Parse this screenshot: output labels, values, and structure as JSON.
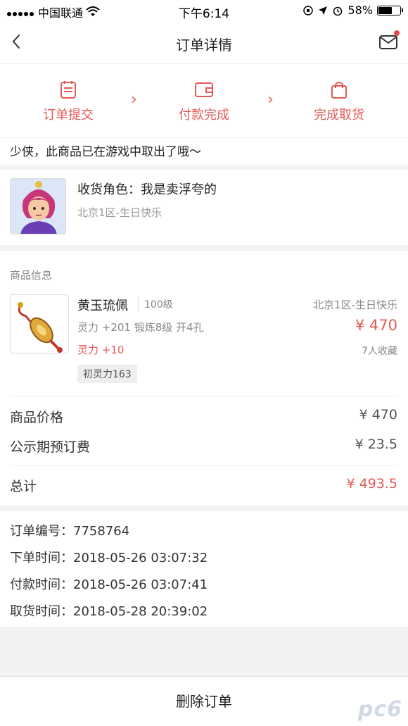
{
  "status_bar": {
    "carrier": "中国联通",
    "time": "下午6:14",
    "battery": "58%"
  },
  "nav": {
    "title": "订单详情"
  },
  "steps": [
    {
      "label": "订单提交",
      "icon": "clipboard-icon"
    },
    {
      "label": "付款完成",
      "icon": "wallet-icon"
    },
    {
      "label": "完成取货",
      "icon": "shopping-bag-icon"
    }
  ],
  "notice": "少侠，此商品已在游戏中取出了哦～",
  "receiver": {
    "name": "收货角色：我是卖浮夸的",
    "server": "北京1区-生日快乐"
  },
  "goods": {
    "section_title": "商品信息",
    "name": "黄玉琉佩",
    "level": "100级",
    "attributes": "灵力 +201 锻炼8级 开4孔",
    "spirit": "灵力 +10",
    "tag": "初灵力163",
    "server": "北京1区-生日快乐",
    "price": "¥ 470",
    "favorites": "7人收藏"
  },
  "summary": {
    "price_label": "商品价格",
    "price_value": "¥ 470",
    "fee_label": "公示期预订费",
    "fee_value": "¥ 23.5",
    "total_label": "总计",
    "total_value": "¥ 493.5"
  },
  "order_info": {
    "order_no": "订单编号：7758764",
    "order_time": "下单时间：2018-05-26 03:07:32",
    "pay_time": "付款时间：2018-05-26 03:07:41",
    "pickup_time": "取货时间：2018-05-28 20:39:02"
  },
  "bottom": {
    "delete_label": "删除订单"
  },
  "watermark": "pc6",
  "colors": {
    "accent": "#e35a55",
    "background": "#f2f2f2"
  }
}
